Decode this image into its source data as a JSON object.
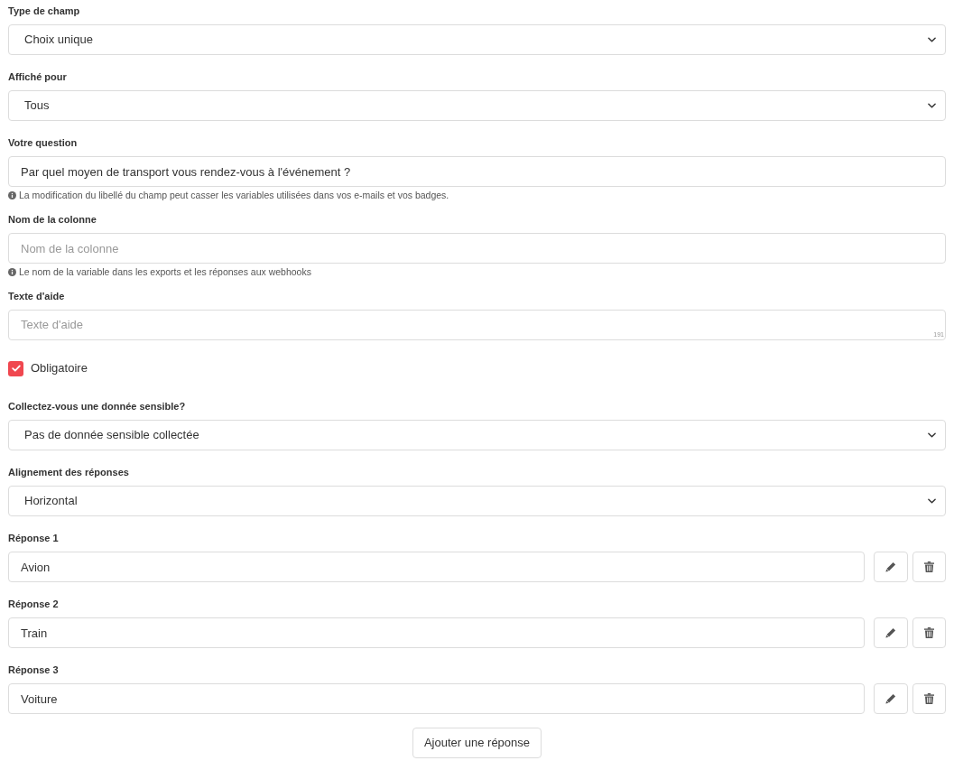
{
  "fields": [
    {
      "kind": "select",
      "label": "Type de champ",
      "value": "Choix unique"
    },
    {
      "kind": "select",
      "label": "Affiché pour",
      "value": "Tous"
    },
    {
      "kind": "input",
      "label": "Votre question",
      "value": "Par quel moyen de transport vous rendez-vous à l'événement ?",
      "help": "La modification du libellé du champ peut casser les variables utilisées dans vos e-mails et vos badges."
    },
    {
      "kind": "input",
      "label": "Nom de la colonne",
      "placeholder": "Nom de la colonne",
      "help": "Le nom de la variable dans les exports et les réponses aux webhooks"
    },
    {
      "kind": "textarea",
      "label": "Texte d'aide",
      "placeholder": "Texte d'aide",
      "counter": "191"
    },
    {
      "kind": "checkbox",
      "label": "Obligatoire",
      "checked": true
    },
    {
      "kind": "select",
      "label": "Collectez-vous une donnée sensible?",
      "value": "Pas de donnée sensible collectée"
    },
    {
      "kind": "select",
      "label": "Alignement des réponses",
      "value": "Horizontal"
    }
  ],
  "answers": [
    {
      "label": "Réponse 1",
      "value": "Avion"
    },
    {
      "label": "Réponse 2",
      "value": "Train"
    },
    {
      "label": "Réponse 3",
      "value": "Voiture"
    }
  ],
  "add_button": "Ajouter une réponse"
}
